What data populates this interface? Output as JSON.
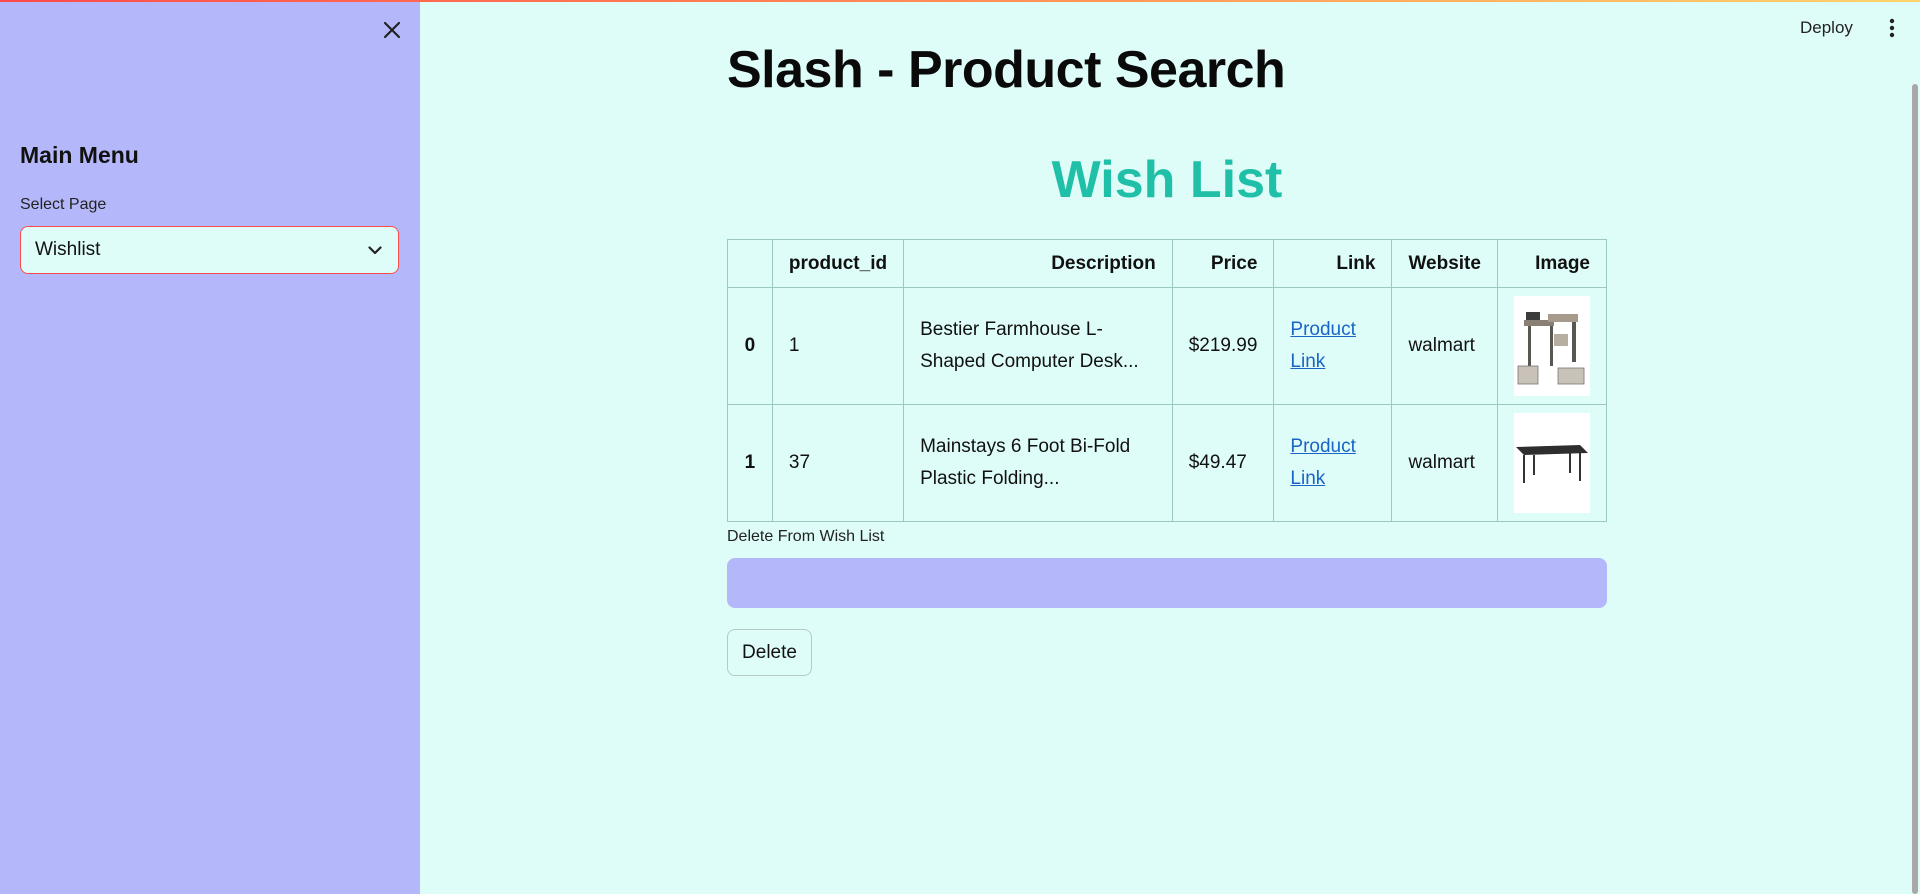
{
  "sidebar": {
    "heading": "Main Menu",
    "select_label": "Select Page",
    "select_value": "Wishlist",
    "background": "#b4b8fa"
  },
  "header": {
    "deploy_label": "Deploy",
    "menu_icon": "kebab-vertical-icon",
    "close_icon": "close-icon"
  },
  "main": {
    "title": "Slash - Product Search",
    "section_heading": "Wish List",
    "accent": "#20c0a8",
    "background": "#dffdf8",
    "table": {
      "columns": [
        "",
        "product_id",
        "Description",
        "Price",
        "Link",
        "Website",
        "Image"
      ],
      "rows": [
        {
          "index": "0",
          "product_id": "1",
          "description": "Bestier Farmhouse L-Shaped Computer Desk...",
          "price": "$219.99",
          "link": "Product Link",
          "website": "walmart",
          "image": "desk-thumbnail"
        },
        {
          "index": "1",
          "product_id": "37",
          "description": "Mainstays 6 Foot Bi-Fold Plastic Folding...",
          "price": "$49.47",
          "link": "Product Link",
          "website": "walmart",
          "image": "folding-table-thumbnail"
        }
      ]
    },
    "delete": {
      "label": "Delete From Wish List",
      "input_value": "",
      "button_label": "Delete"
    }
  }
}
